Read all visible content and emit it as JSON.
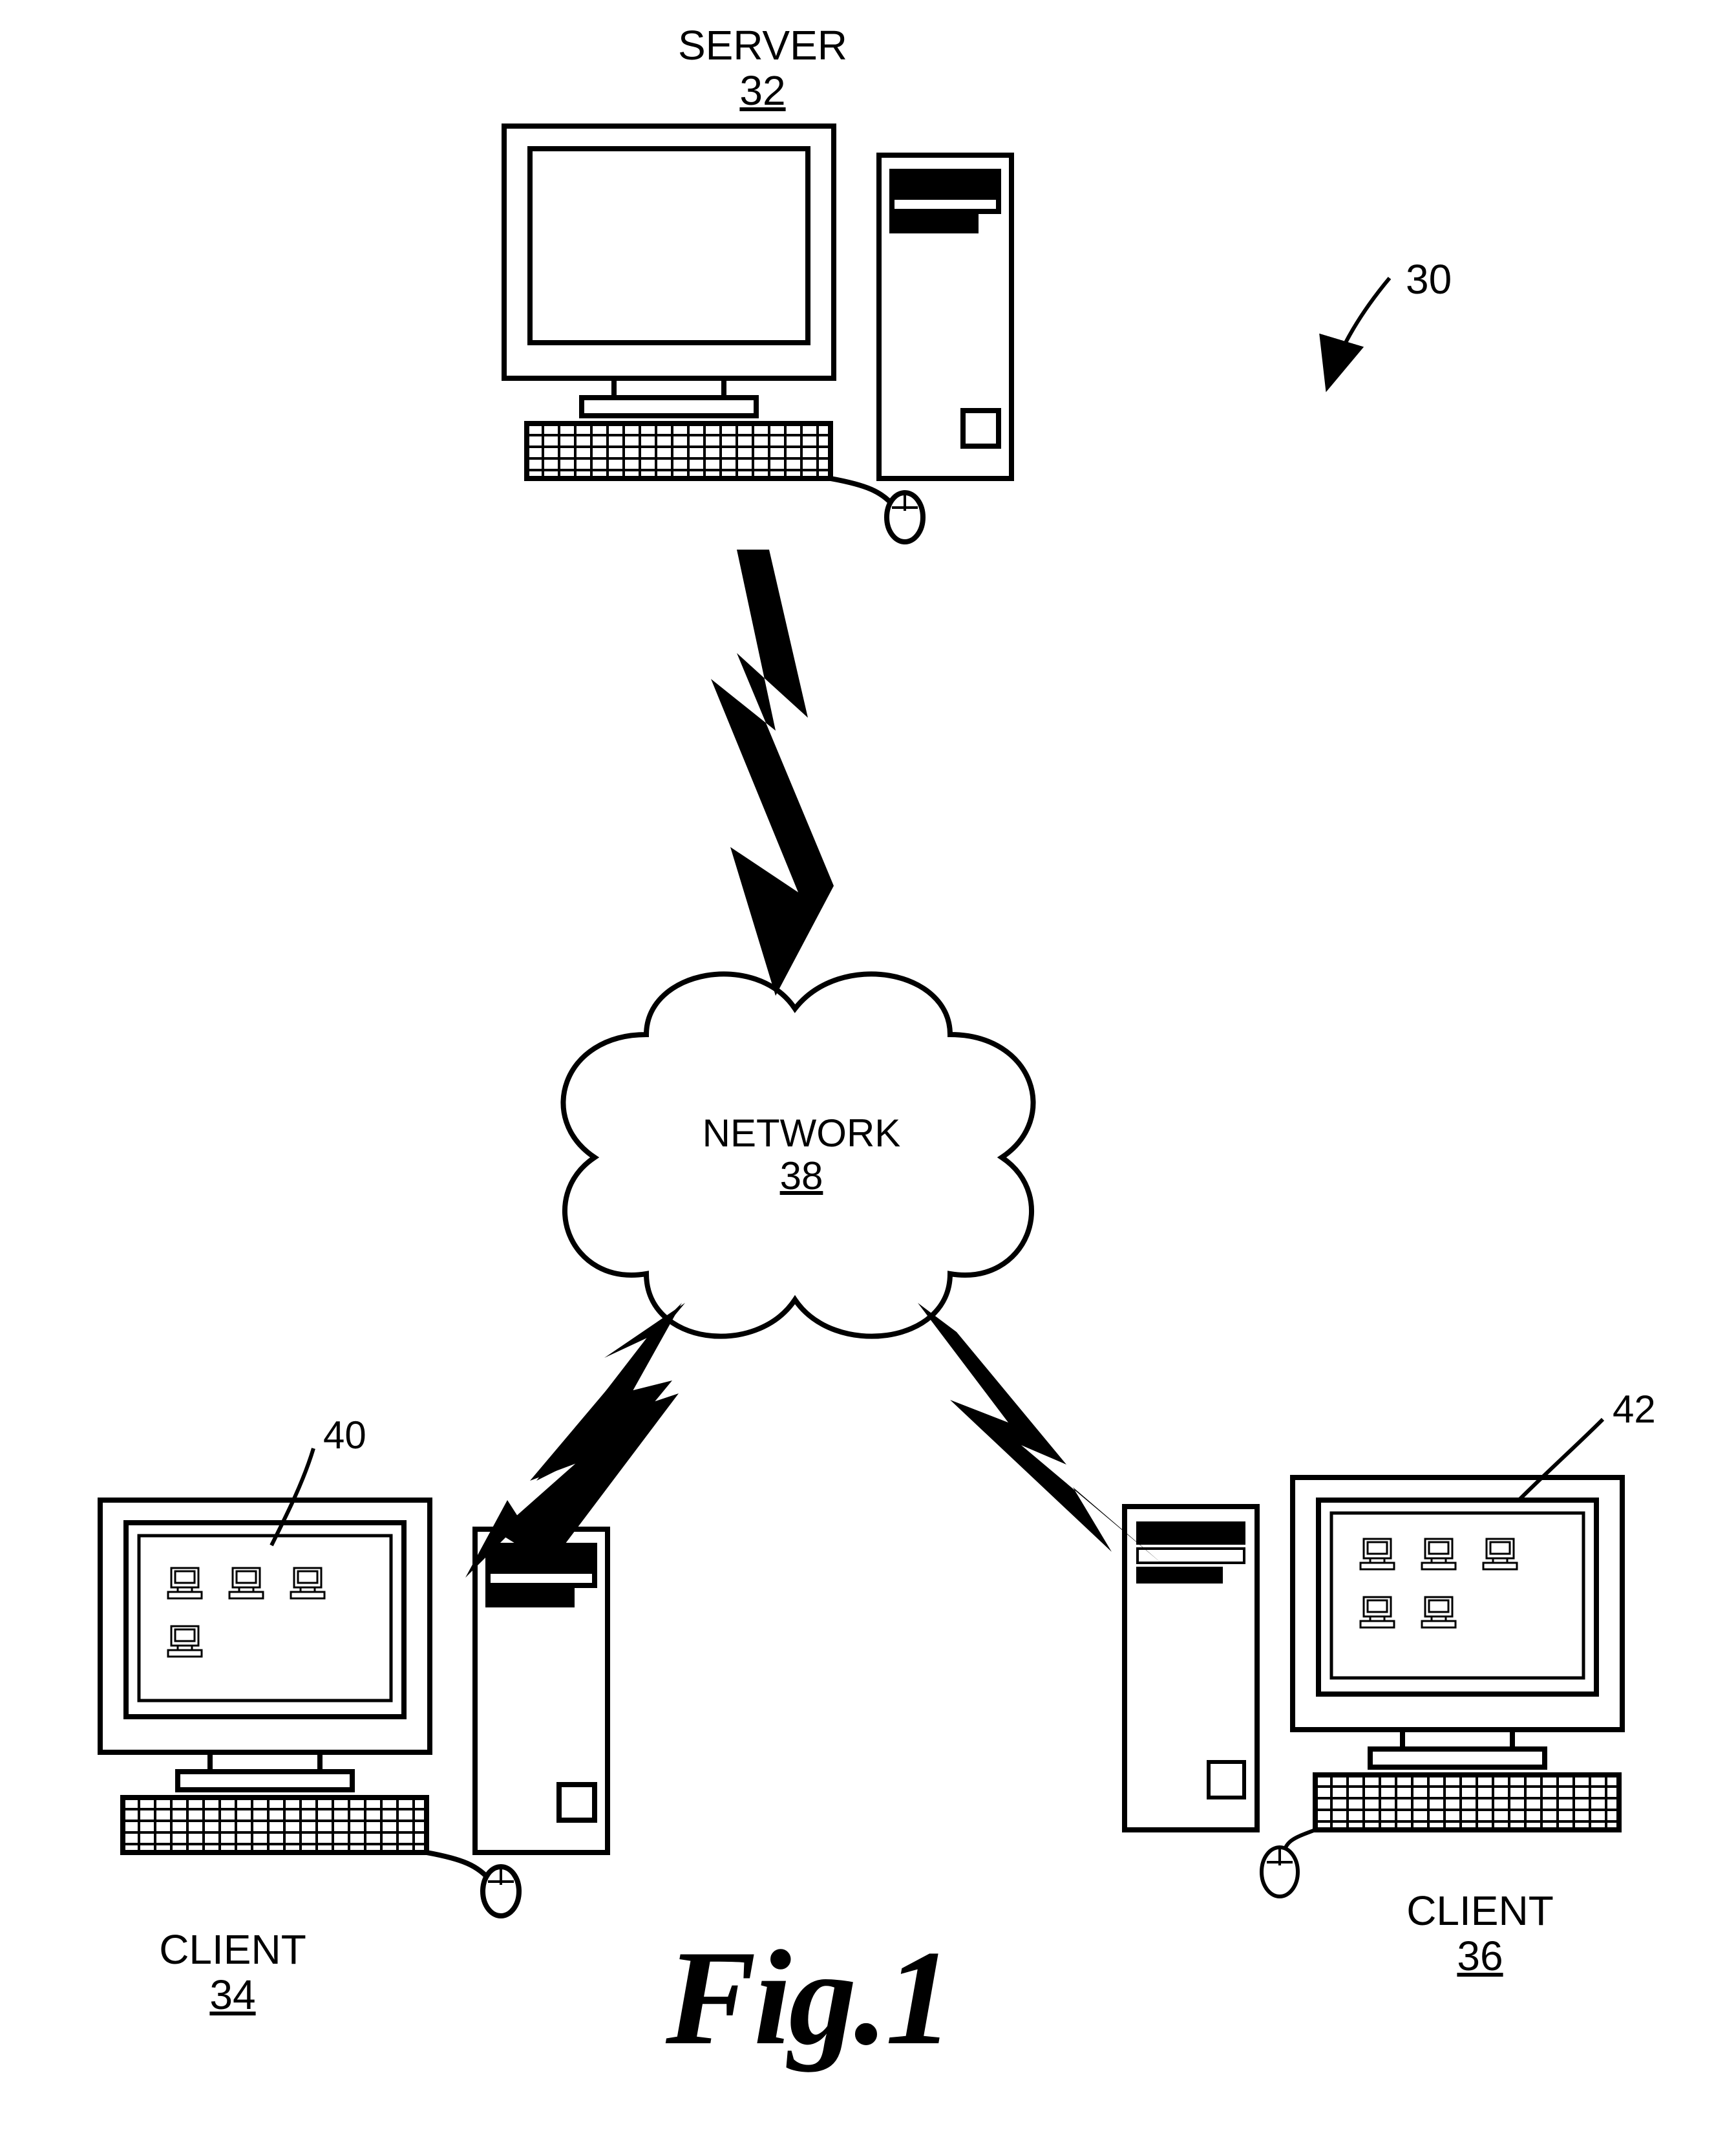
{
  "figure": {
    "caption": "Fig.1",
    "reference_mark": "30"
  },
  "nodes": {
    "server": {
      "label": "SERVER",
      "ref": "32"
    },
    "network": {
      "label": "NETWORK",
      "ref": "38"
    },
    "client_left": {
      "label": "CLIENT",
      "ref": "34",
      "screen_ref": "40"
    },
    "client_right": {
      "label": "CLIENT",
      "ref": "36",
      "screen_ref": "42"
    }
  }
}
